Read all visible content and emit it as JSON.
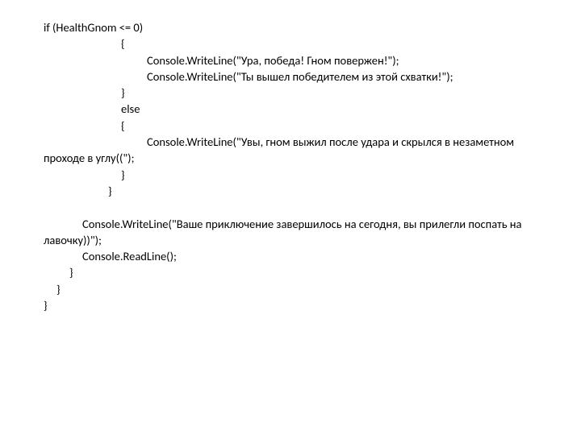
{
  "code": {
    "l1": "if (HealthGnom <= 0)",
    "l2": "{",
    "l3": "Console.WriteLine(\"Ура, победа! Гном повержен!\");",
    "l4": "Console.WriteLine(\"Ты вышел победителем из этой схватки!\");",
    "l5": "}",
    "l6": "else",
    "l7": "{",
    "l8": "Console.WriteLine(\"Увы, гном выжил после удара и скрылся в незаметном проходе в углу((\");",
    "l9": "}",
    "l10": "}",
    "blank1": "",
    "l11": "Console.WriteLine(\"Ваше приключение завершилось на сегодня, вы прилегли поспать на лавочку))\");",
    "l12": "Console.ReadLine();",
    "l13": "}",
    "l14": "}",
    "l15": "}"
  }
}
